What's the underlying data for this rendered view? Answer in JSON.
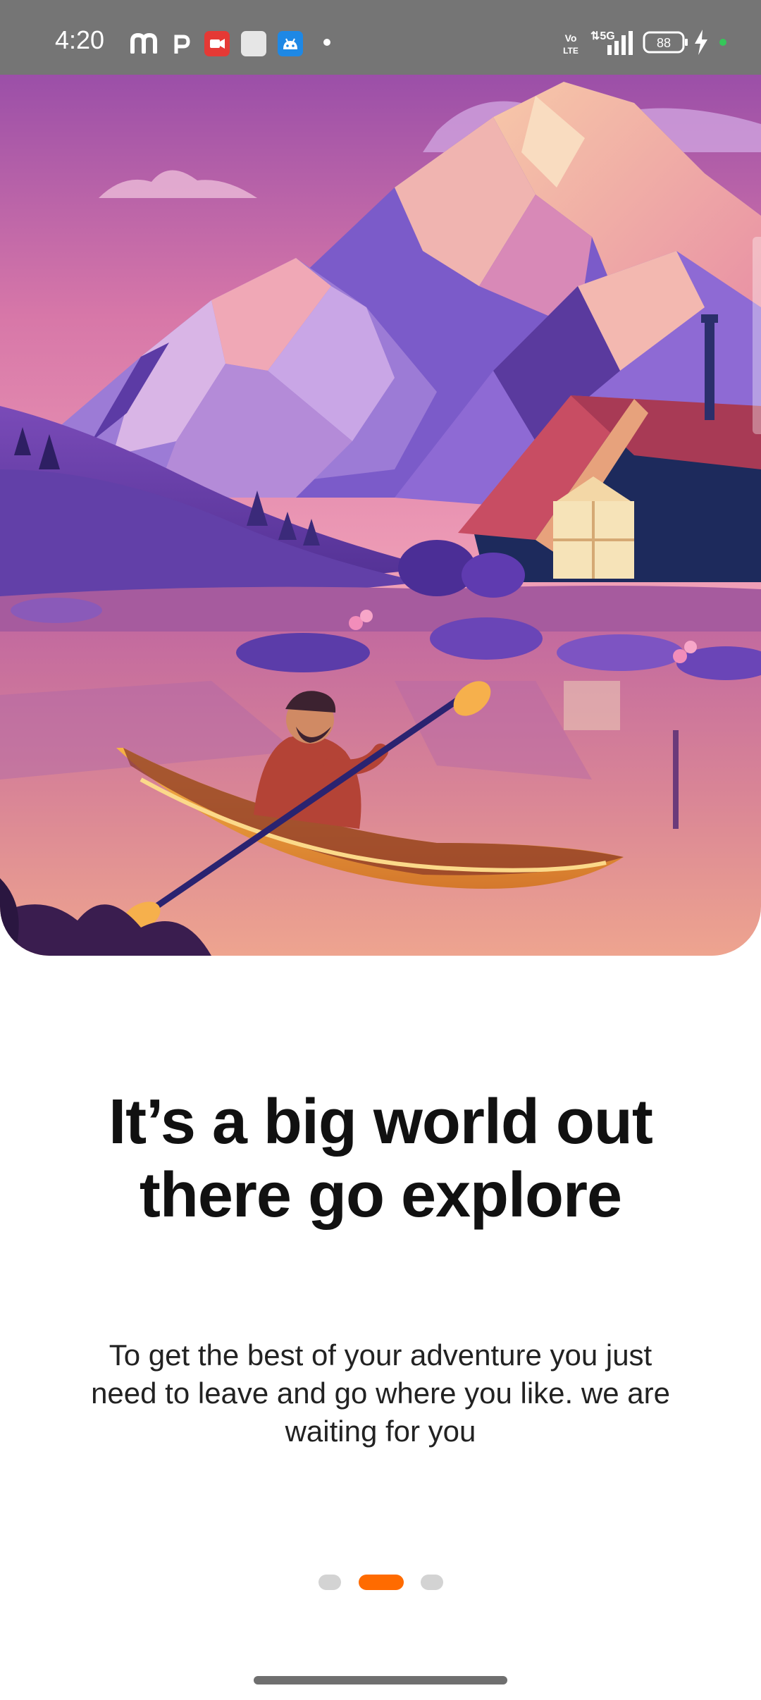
{
  "status_bar": {
    "time": "4:20",
    "network_label": "5G",
    "volte_label": "Vo LTE",
    "battery_level": "88",
    "icons": [
      "m-app-icon",
      "p-app-icon",
      "video-app-icon",
      "blank-app-icon",
      "android-app-icon",
      "more-dot-icon",
      "volte-icon",
      "signal-icon",
      "battery-icon",
      "charging-icon",
      "active-dot-icon"
    ],
    "colors": {
      "background": "#757575",
      "video_icon": "#e53935",
      "android_icon": "#1e88e5",
      "active_dot": "#35c759"
    }
  },
  "hero": {
    "illustration": "mountain-lake-cabin-kayak-illustration"
  },
  "onboarding": {
    "title_line1": "It’s a big world out",
    "title_line2": "there go explore",
    "description_line1": "To get the best of your adventure you just",
    "description_line2": "need to leave and go where you like. we are",
    "description_line3": "waiting for you",
    "page_index": 2,
    "page_count": 3
  },
  "colors": {
    "accent": "#ff6b00",
    "dot_inactive": "#d3d3d3",
    "title": "#111111",
    "body": "#222222"
  }
}
